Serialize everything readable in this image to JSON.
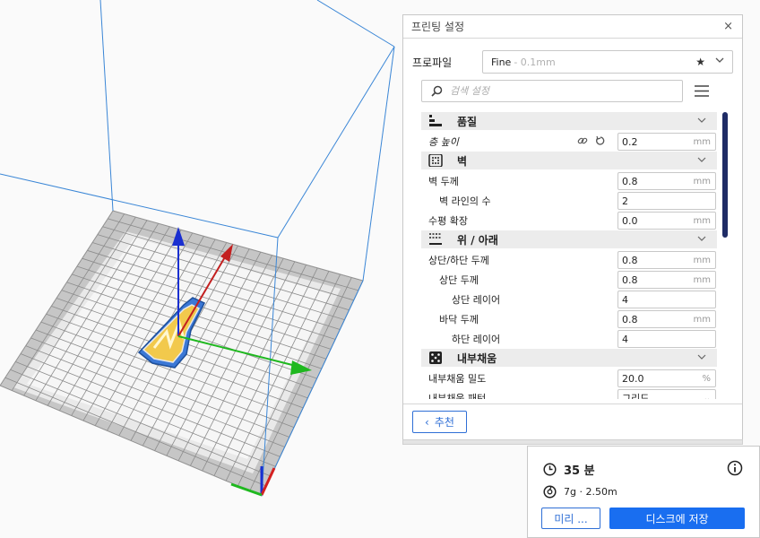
{
  "panel": {
    "title": "프린팅 설정",
    "close_glyph": "×",
    "profile_label": "프로파일",
    "profile_name": "Fine",
    "profile_detail": "- 0.1mm",
    "search_placeholder": "검색 설정",
    "recommend_label": "추천",
    "recommend_glyph": "‹"
  },
  "settings": {
    "quality": {
      "label": "품질",
      "layer_height_label": "층 높이",
      "layer_height": "0.2",
      "unit": "mm"
    },
    "walls": {
      "label": "벽",
      "thickness_label": "벽 두께",
      "thickness": "0.8",
      "thickness_unit": "mm",
      "line_count_label": "벽 라인의 수",
      "line_count": "2",
      "expansion_label": "수평 확장",
      "expansion": "0.0",
      "expansion_unit": "mm"
    },
    "topbottom": {
      "label": "위 / 아래",
      "tb_thickness_label": "상단/하단 두께",
      "tb_thickness": "0.8",
      "tb_unit": "mm",
      "top_thickness_label": "상단 두께",
      "top_thickness": "0.8",
      "top_unit": "mm",
      "top_layers_label": "상단 레이어",
      "top_layers": "4",
      "bottom_thickness_label": "바닥 두께",
      "bottom_thickness": "0.8",
      "bottom_unit": "mm",
      "bottom_layers_label": "하단 레이어",
      "bottom_layers": "4"
    },
    "infill": {
      "label": "내부채움",
      "density_label": "내부채움 밀도",
      "density": "20.0",
      "density_unit": "%",
      "pattern_label": "내부채움 패턴",
      "pattern": "그리드"
    }
  },
  "output": {
    "time": "35 분",
    "material": "7g · 2.50m",
    "preview_label": "미리 ...",
    "save_label": "디스크에 저장"
  },
  "colors": {
    "accent": "#196ef0",
    "scrollbar": "#1f2c66",
    "build_volume": "#3a86d6",
    "axis_x": "#1fb81f",
    "axis_y": "#c32020",
    "axis_z": "#1a2fd0",
    "model": "#f2c94c"
  },
  "icons": [
    "close-icon",
    "star-icon",
    "chevron-down-icon",
    "search-icon",
    "menu-icon",
    "link-icon",
    "reset-icon",
    "quality-icon",
    "wall-icon",
    "topbottom-icon",
    "infill-icon",
    "clock-icon",
    "info-icon",
    "filament-icon"
  ]
}
